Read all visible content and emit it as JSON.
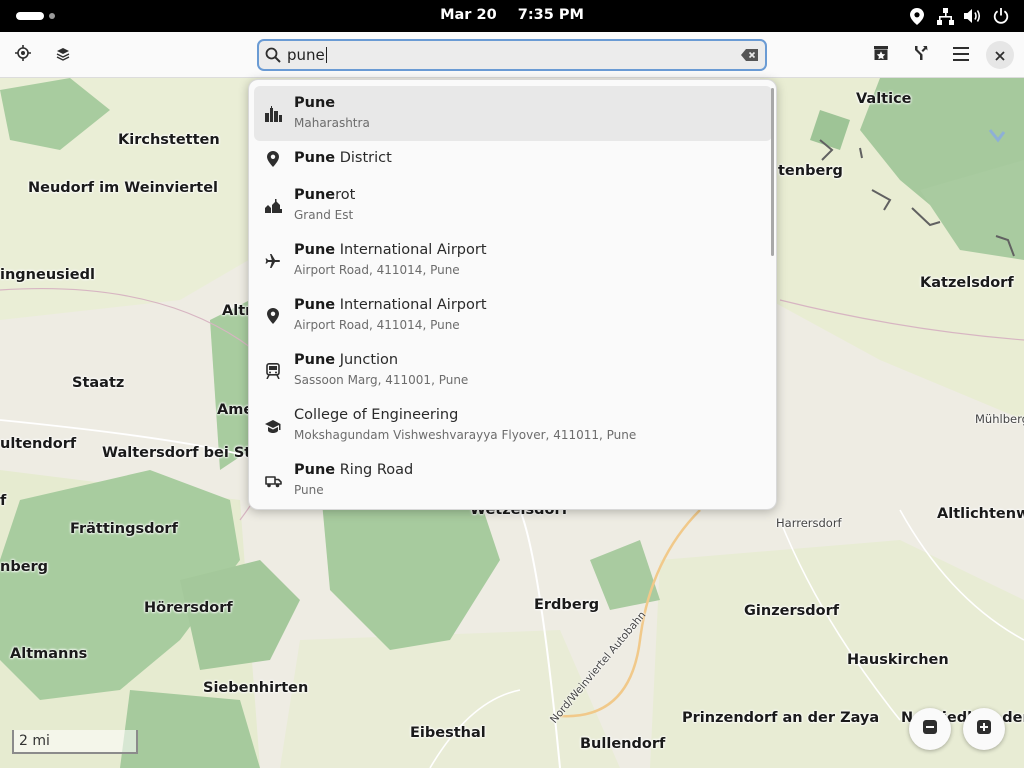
{
  "top_bar": {
    "date": "Mar 20",
    "time": "7:35 PM",
    "status_icons": [
      "location-icon",
      "network-icon",
      "volume-icon",
      "power-icon"
    ]
  },
  "header": {
    "left_buttons": [
      "locate-icon",
      "layers-icon"
    ],
    "right_buttons": [
      "favorites-icon",
      "route-icon",
      "menu-icon",
      "close-icon"
    ],
    "search": {
      "value": "pune",
      "placeholder": ""
    }
  },
  "results": [
    {
      "bold": "Pune",
      "rest": "",
      "subtitle": "Maharashtra",
      "icon": "city-icon",
      "selected": true
    },
    {
      "bold": "Pune",
      "rest": " District",
      "subtitle": "",
      "icon": "pin-icon",
      "selected": false
    },
    {
      "bold": "Pune",
      "rest": "rot",
      "subtitle": "Grand Est",
      "icon": "village-icon",
      "selected": false
    },
    {
      "bold": "Pune",
      "rest": " International Airport",
      "subtitle": "Airport Road, 411014, Pune",
      "icon": "airplane-icon",
      "selected": false
    },
    {
      "bold": "Pune",
      "rest": " International Airport",
      "subtitle": "Airport Road, 411014, Pune",
      "icon": "pin-icon",
      "selected": false
    },
    {
      "bold": "Pune",
      "rest": " Junction",
      "subtitle": "Sassoon Marg, 411001, Pune",
      "icon": "train-icon",
      "selected": false
    },
    {
      "bold": "",
      "rest": "College of Engineering",
      "subtitle": "Mokshagundam Vishweshvarayya Flyover, 411011, Pune",
      "icon": "school-icon",
      "selected": false
    },
    {
      "bold": "Pune",
      "rest": " Ring Road",
      "subtitle": "Pune",
      "icon": "car-icon",
      "selected": false
    }
  ],
  "map": {
    "places": [
      "Valtice",
      "Kirchstetten",
      "tenberg",
      "Neudorf im Weinviertel",
      "ingneusiedl",
      "Katzelsdorf",
      "Altr",
      "Staatz",
      "Ame",
      "Mühlberg",
      "ultendorf",
      "Waltersdorf bei Staa",
      "Wetzelsdorf",
      "Harrersdorf",
      "Altlichtenwa",
      "f",
      "Frättingsdorf",
      "nberg",
      "Erdberg",
      "Hörersdorf",
      "Ginzersdorf",
      "Altmanns",
      "Hauskirchen",
      "Siebenhirten",
      "Prinzendorf an der Zaya",
      "Neusiedl an der Z",
      "Eibesthal",
      "Bullendorf"
    ],
    "road_label": "Nord/Weinviertel Autobahn",
    "scale": "2 mi"
  },
  "zoom": {
    "out_icon": "zoom-out-icon",
    "in_icon": "zoom-in-icon"
  }
}
